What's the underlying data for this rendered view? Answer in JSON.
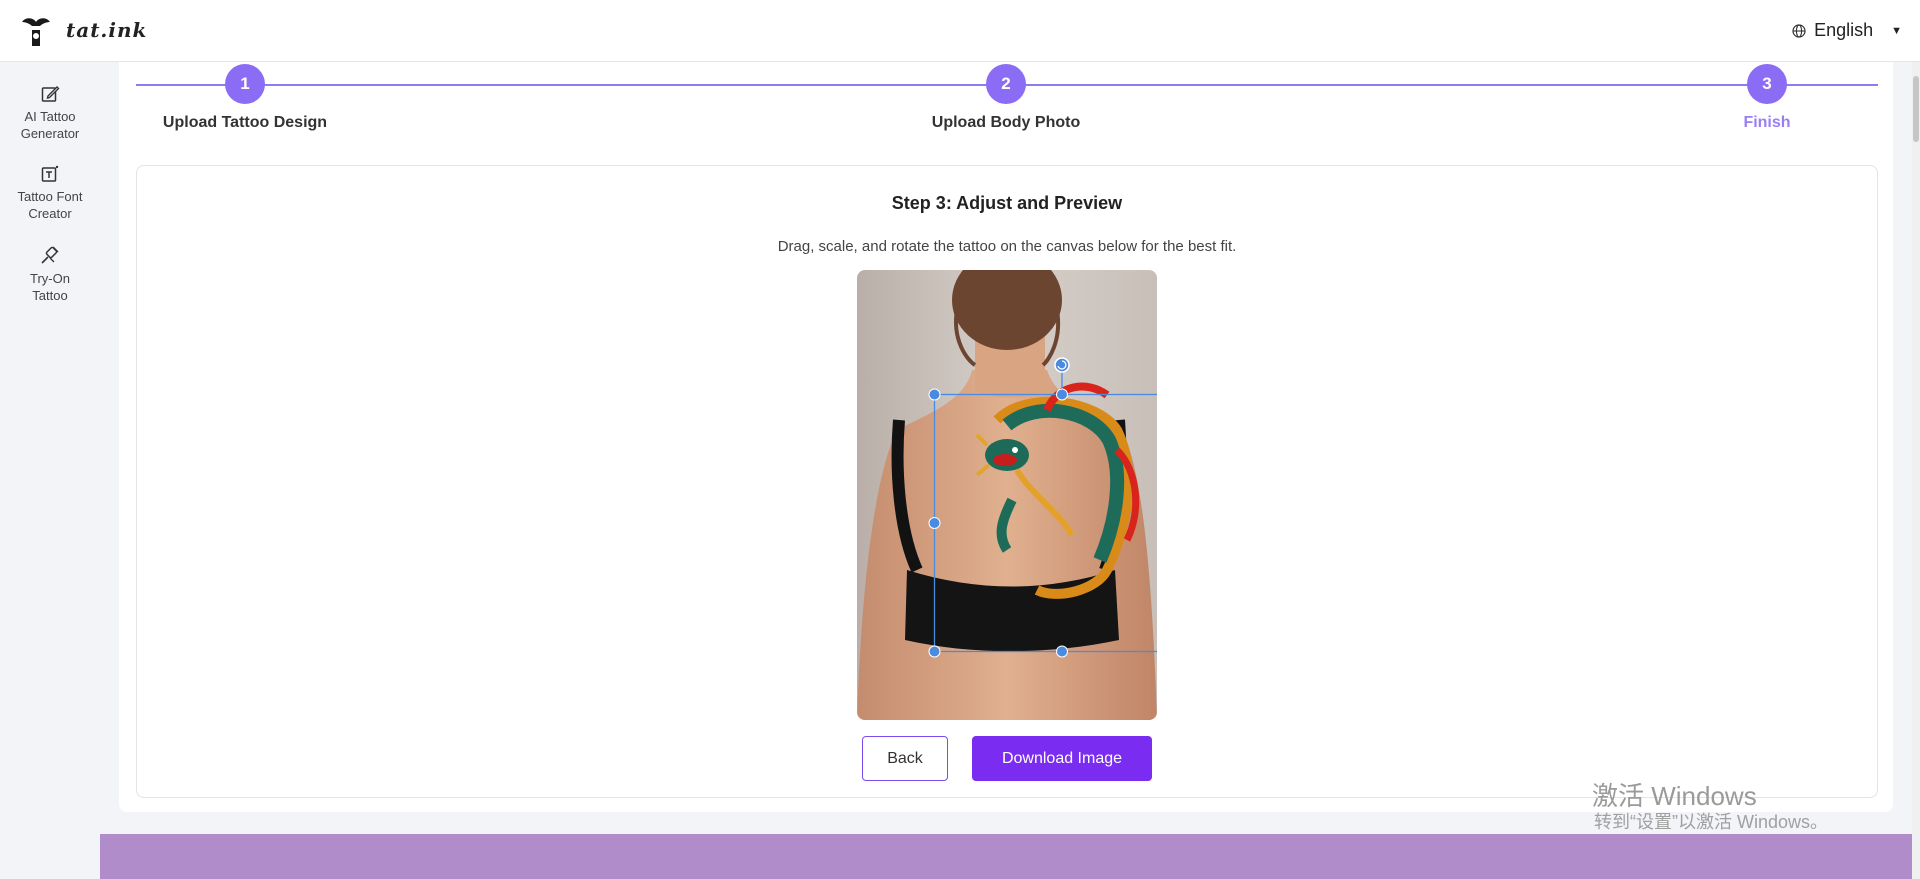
{
  "header": {
    "brand": "tat.ink",
    "language": "English"
  },
  "sidebar": {
    "items": [
      {
        "label_line1": "AI Tattoo",
        "label_line2": "Generator",
        "icon": "edit-icon"
      },
      {
        "label_line1": "Tattoo Font",
        "label_line2": "Creator",
        "icon": "text-edit-icon"
      },
      {
        "label_line1": "Try-On",
        "label_line2": "Tattoo",
        "icon": "tattoo-machine-icon"
      }
    ]
  },
  "stepper": {
    "steps": [
      {
        "number": "1",
        "label": "Upload Tattoo Design"
      },
      {
        "number": "2",
        "label": "Upload Body Photo"
      },
      {
        "number": "3",
        "label": "Finish"
      }
    ],
    "active_step": 3
  },
  "content": {
    "title": "Step 3: Adjust and Preview",
    "subtitle": "Drag, scale, and rotate the tattoo on the canvas below for the best fit."
  },
  "buttons": {
    "back": "Back",
    "download": "Download Image"
  },
  "watermark": {
    "line1": "激活 Windows",
    "line2": "转到“设置”以激活 Windows。"
  },
  "colors": {
    "accent": "#8b6cf5",
    "download_button": "#7a2cf0",
    "footer_band": "#b08ccb",
    "handle": "#4a8be0"
  }
}
